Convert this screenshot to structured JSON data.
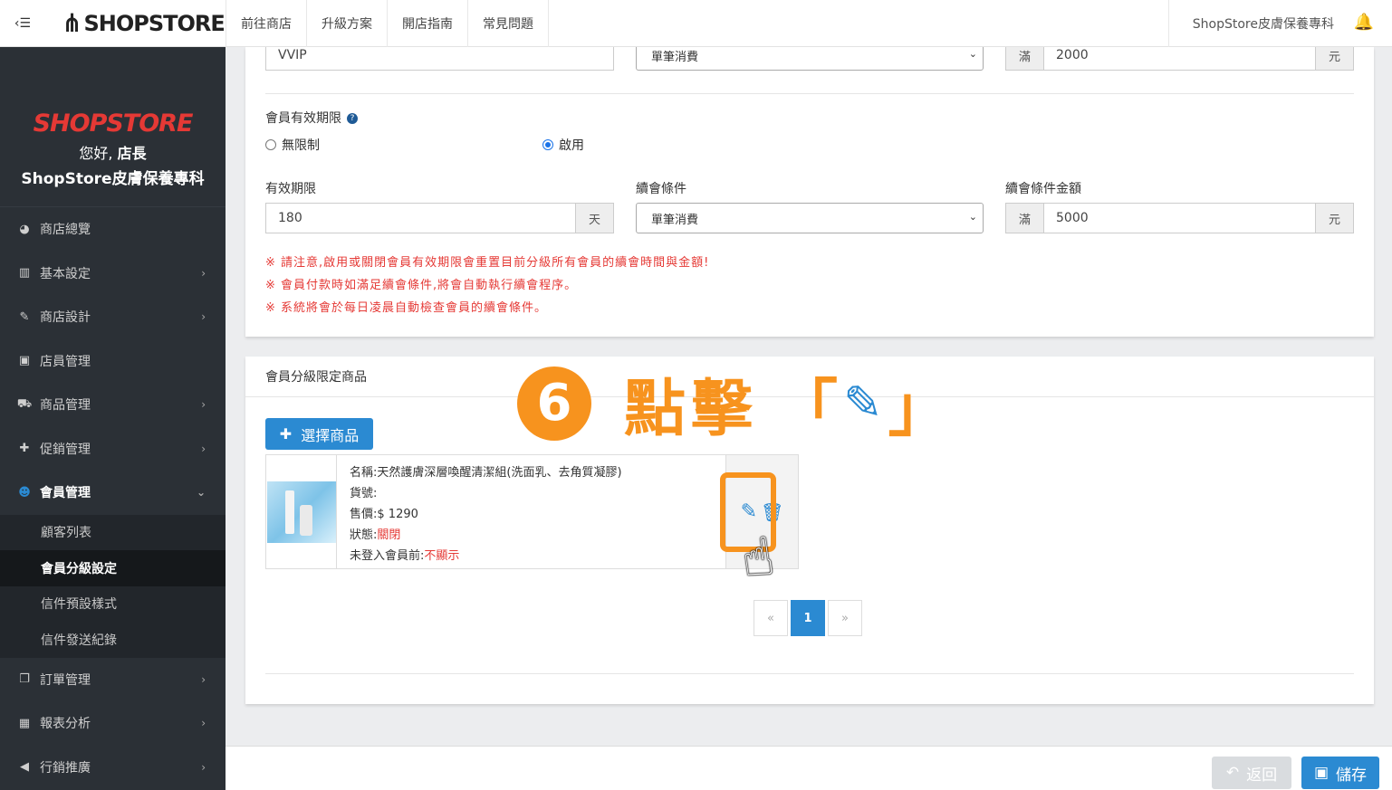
{
  "topbar": {
    "menu_toggle": "‹☰",
    "brand": "SHOPSTORE",
    "nav": [
      "前往商店",
      "升級方案",
      "開店指南",
      "常見問題"
    ],
    "shop_name": "ShopStore皮膚保養專科",
    "bell_icon": "bell-icon"
  },
  "sidebar": {
    "logo": "SHOPSTORE",
    "greeting_prefix": "您好,",
    "greeting_role": "店長",
    "shop_name": "ShopStore皮膚保養專科",
    "menu": [
      {
        "label": "商店總覽",
        "icon": "dashboard-icon",
        "glyph": "◕"
      },
      {
        "label": "基本設定",
        "icon": "bank-icon",
        "glyph": "▥"
      },
      {
        "label": "商店設計",
        "icon": "magic-wand-icon",
        "glyph": "✎"
      },
      {
        "label": "店員管理",
        "icon": "lock-icon",
        "glyph": "▣"
      },
      {
        "label": "商品管理",
        "icon": "cart-icon",
        "glyph": "⛟"
      },
      {
        "label": "促銷管理",
        "icon": "gift-icon",
        "glyph": "✚"
      },
      {
        "label": "會員管理",
        "icon": "users-icon",
        "glyph": "☻"
      },
      {
        "label": "訂單管理",
        "icon": "copy-icon",
        "glyph": "❐"
      },
      {
        "label": "報表分析",
        "icon": "bar-chart-icon",
        "glyph": "▦"
      },
      {
        "label": "行銷推廣",
        "icon": "bullhorn-icon",
        "glyph": "◀"
      }
    ],
    "submenu": [
      "顧客列表",
      "會員分級設定",
      "信件預設樣式",
      "信件發送紀錄"
    ]
  },
  "form": {
    "level_name": "VVIP",
    "upgrade_condition": "單筆消費",
    "upgrade_prefix": "滿",
    "upgrade_amount": "2000",
    "upgrade_suffix": "元",
    "validity_label": "會員有效期限",
    "radio_unlimited": "無限制",
    "radio_enabled": "啟用",
    "period_label": "有效期限",
    "period_value": "180",
    "period_suffix": "天",
    "renew_label": "續會條件",
    "renew_condition": "單筆消費",
    "renew_amount_label": "續會條件金額",
    "renew_prefix": "滿",
    "renew_amount": "5000",
    "renew_suffix": "元",
    "notes": [
      "※ 請注意,啟用或關閉會員有效期限會重置目前分級所有會員的續會時間與金額!",
      "※ 會員付款時如滿足續會條件,將會自動執行續會程序。",
      "※ 系統將會於每日凌晨自動檢查會員的續會條件。"
    ]
  },
  "products_card": {
    "title": "會員分級限定商品",
    "select_button": "選擇商品",
    "product": {
      "name_label": "名稱:",
      "name": "天然護膚深層喚醒清潔組(洗面乳、去角質凝膠)",
      "sku_label": "貨號:",
      "sku": "",
      "price_label": "售價:",
      "price": "$ 1290",
      "status_label": "狀態:",
      "status": "關閉",
      "guest_label": "未登入會員前:",
      "guest": "不顯示"
    },
    "pager": {
      "prev": "«",
      "page": "1",
      "next": "»"
    }
  },
  "annotation": {
    "step": "6",
    "text": "點擊",
    "bracket_open": "「",
    "bracket_close": "」"
  },
  "footer": {
    "back": "返回",
    "save": "儲存"
  },
  "colors": {
    "accent": "#2b8ad2",
    "annotation": "#f7931e",
    "alert": "#e53935",
    "sidebar": "#2b3036"
  }
}
